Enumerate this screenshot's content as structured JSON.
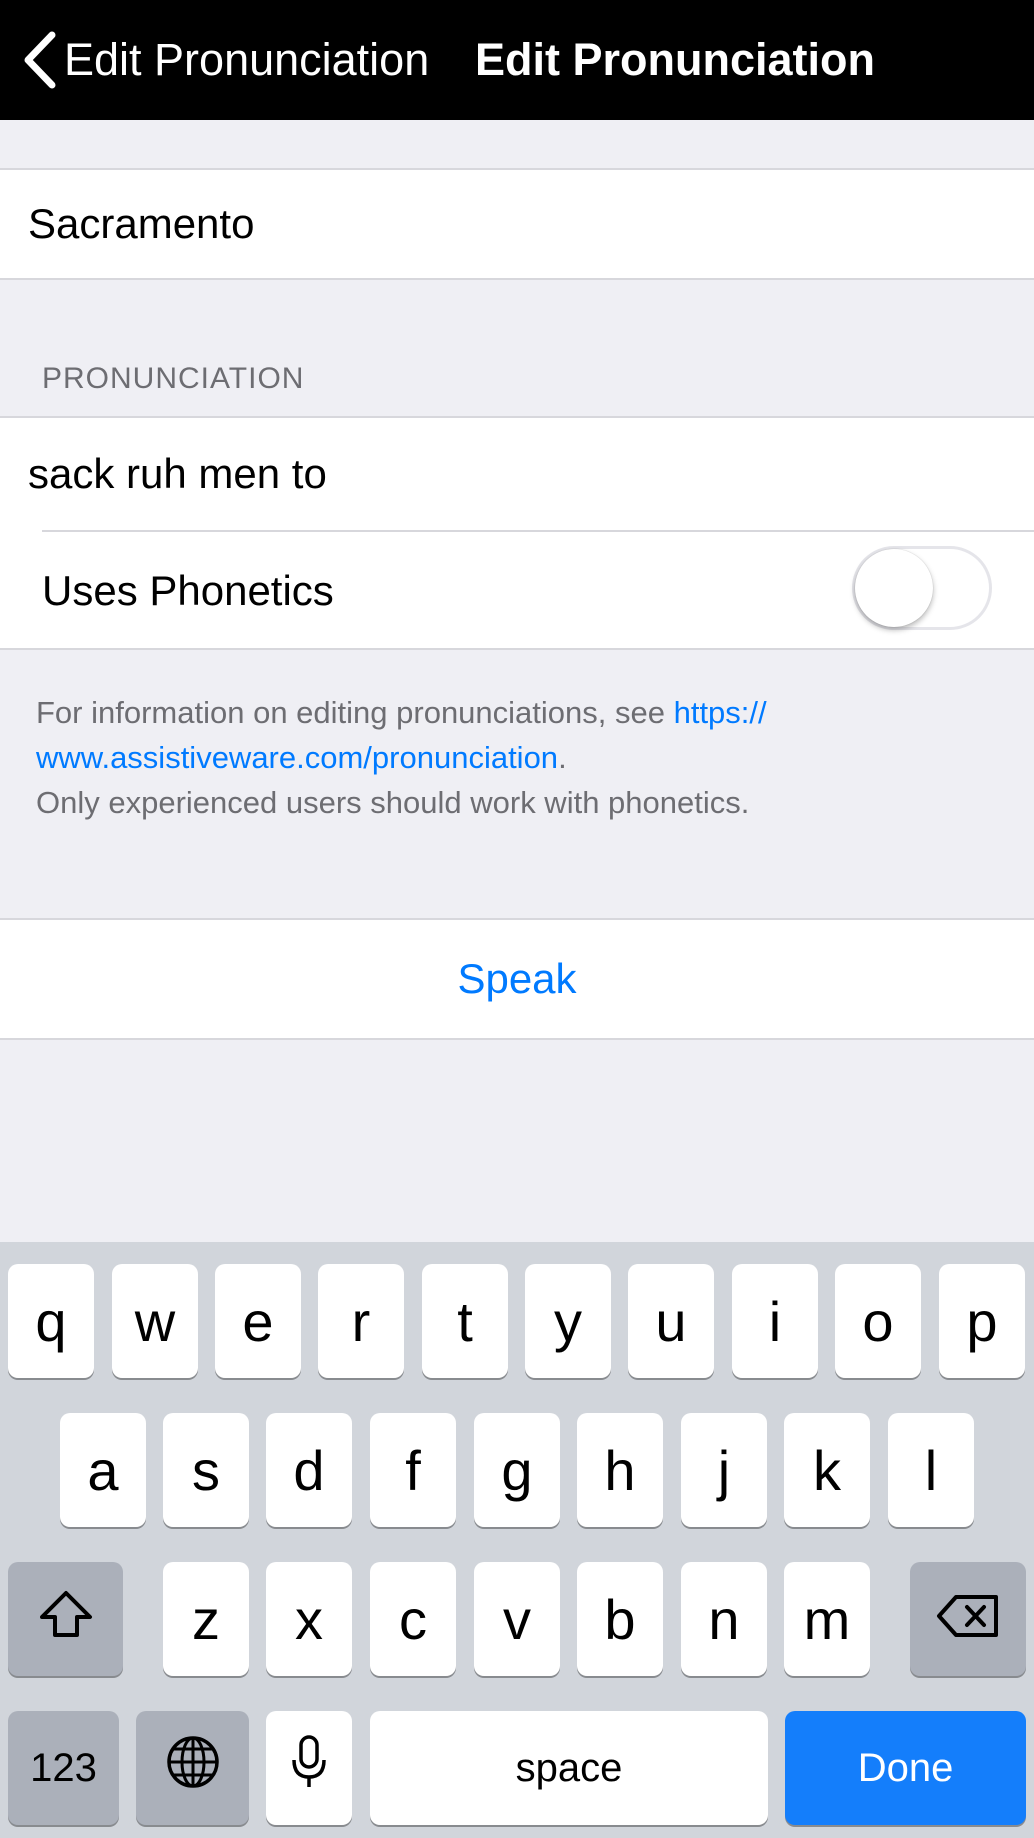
{
  "navbar": {
    "back_label": "Edit Pronunciation",
    "title": "Edit Pronunciation"
  },
  "word": {
    "value": "Sacramento"
  },
  "pronunciation_section": {
    "header": "PRONUNCIATION",
    "value": "sack ruh men to",
    "phonetics_label": "Uses Phonetics",
    "phonetics_on": false
  },
  "footer": {
    "text_before": "For information on editing pronunciations, see ",
    "link_part1": "https://",
    "link_part2": "www.assistiveware.com/pronunciation",
    "period": ".",
    "line3": "Only experienced users should work with phonetics."
  },
  "speak_label": "Speak",
  "keyboard": {
    "row1": [
      "q",
      "w",
      "e",
      "r",
      "t",
      "y",
      "u",
      "i",
      "o",
      "p"
    ],
    "row2": [
      "a",
      "s",
      "d",
      "f",
      "g",
      "h",
      "j",
      "k",
      "l"
    ],
    "row3": [
      "z",
      "x",
      "c",
      "v",
      "b",
      "n",
      "m"
    ],
    "numbers_label": "123",
    "space_label": "space",
    "done_label": "Done",
    "shift_icon": "shift-icon",
    "delete_icon": "delete-icon",
    "globe_icon": "globe-icon",
    "mic_icon": "microphone-icon"
  },
  "colors": {
    "accent": "#007aff",
    "done_key": "#147efb",
    "background": "#efeff4"
  }
}
